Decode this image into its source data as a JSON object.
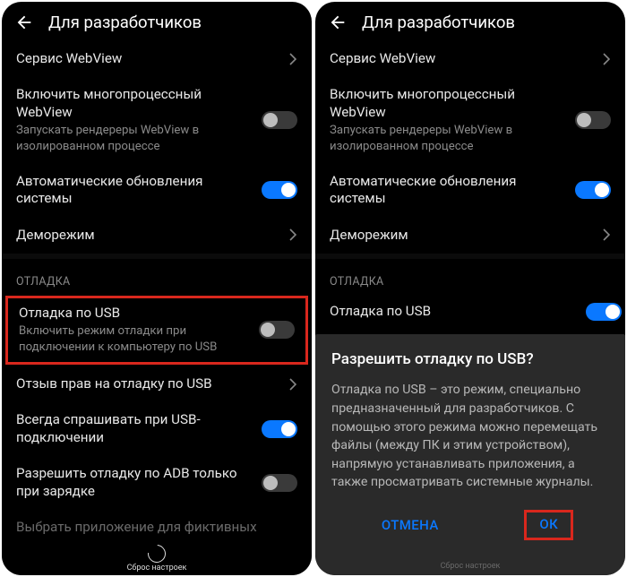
{
  "header": {
    "title": "Для разработчиков"
  },
  "left": {
    "webview_service": "Сервис WebView",
    "multiprocess": {
      "title": "Включить многопроцессный WebView",
      "sub": "Запускать рендереры WebView в изолированном процессе"
    },
    "auto_update": "Автоматические обновления системы",
    "demo": "Деморежим",
    "section": "ОТЛАДКА",
    "usb_debug": {
      "title": "Отладка по USB",
      "sub": "Включить режим отладки при подключении к компьютеру по USB"
    },
    "revoke": "Отзыв прав на отладку по USB",
    "always_ask": "Всегда спрашивать при USB-подключении",
    "adb_charging": "Разрешить отладку по ADB только при зарядке",
    "mock_app": "Выбрать приложение для фиктивных",
    "reset": "Сброс настроек"
  },
  "right": {
    "webview_service": "Сервис WebView",
    "multiprocess": {
      "title": "Включить многопроцессный WebView",
      "sub": "Запускать рендереры WebView в изолированном процессе"
    },
    "auto_update": "Автоматические обновления системы",
    "demo": "Деморежим",
    "section": "ОТЛАДКА",
    "usb_debug": "Отладка по USB",
    "reset": "Сброс настроек"
  },
  "dialog": {
    "title": "Разрешить отладку по USB?",
    "body": "Отладка по USB – это режим, специально предназначенный для разработчиков. С помощью этого режима можно перемещать файлы (между ПК и этим устройством), напрямую устанавливать приложения, а также просматривать системные журналы.",
    "cancel": "ОТМЕНА",
    "ok": "ОК"
  }
}
